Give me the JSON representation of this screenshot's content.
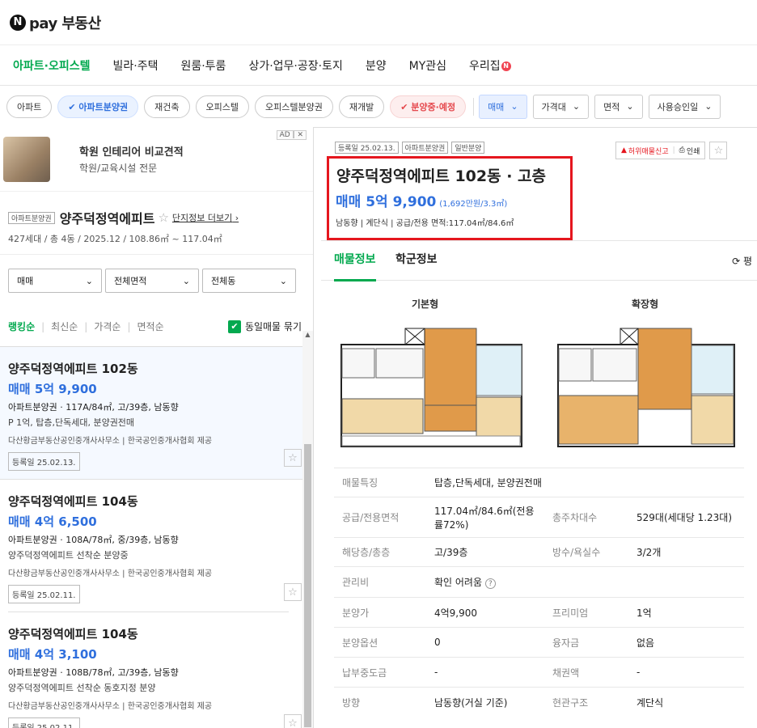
{
  "brand": {
    "logo_letter": "N",
    "name": "pay 부동산"
  },
  "nav": {
    "items": [
      "아파트·오피스텔",
      "빌라·주택",
      "원룸·투룸",
      "상가·업무·공장·토지",
      "분양",
      "MY관심",
      "우리집"
    ],
    "badge": "N"
  },
  "filters": {
    "chips": [
      "아파트",
      "✔ 아파트분양권",
      "재건축",
      "오피스텔",
      "오피스텔분양권",
      "재개발",
      "✔ 분양중·예정"
    ],
    "dropdowns": [
      "매매",
      "가격대",
      "면적",
      "사용승인일"
    ]
  },
  "ad": {
    "title": "학원 인테리어 비교견적",
    "subtitle": "학원/교육시설 전문",
    "tag": "AD",
    "close": "✕"
  },
  "complex": {
    "tag": "아파트분양권",
    "name": "양주덕정역에피트",
    "more": "단지정보 더보기",
    "summary": "427세대 / 총 4동 / 2025.12 / 108.86㎡ ~ 117.04㎡"
  },
  "selects": [
    "매매",
    "전체면적",
    "전체동"
  ],
  "sort": {
    "options": [
      "랭킹순",
      "최신순",
      "가격순",
      "면적순"
    ],
    "same_label": "동일매물 묶기"
  },
  "listings": [
    {
      "title": "양주덕정역에피트 102동",
      "price": "매매 5억 9,900",
      "info": "아파트분양권 · 117A/84㎡, 고/39층, 남동향",
      "desc": "P 1억, 탑층,단독세대, 분양권전매",
      "agency": "다산황금부동산공인중개사사무소 | 한국공인중개사협회 제공",
      "reg": "등록일 25.02.13."
    },
    {
      "title": "양주덕정역에피트 104동",
      "price": "매매 4억 6,500",
      "info": "아파트분양권 · 108A/78㎡, 중/39층, 남동향",
      "desc": "양주덕정역에피트 선착순 분양중",
      "agency": "다산황금부동산공인중개사사무소 | 한국공인중개사협회 제공",
      "reg": "등록일 25.02.11."
    },
    {
      "title": "양주덕정역에피트 104동",
      "price": "매매 4억 3,100",
      "info": "아파트분양권 · 108B/78㎡, 고/39층, 남동향",
      "desc": "양주덕정역에피트 선착순 동호지정 분양",
      "agency": "다산황금부동산공인중개사사무소 | 한국공인중개사협회 제공",
      "reg": "등록일 25.02.11."
    }
  ],
  "detail": {
    "tags": [
      "등록일 25.02.13.",
      "아파트분양권",
      "일반분양"
    ],
    "report": "허위매물신고",
    "print": "인쇄",
    "title": "양주덕정역에피트 102동 · 고층",
    "price": "매매 5억 9,900",
    "unit_price": "(1,692만원/3.3㎡)",
    "specs": "남동향 | 계단식 | 공급/전용 면적:117.04㎡/84.6㎡",
    "tabs": [
      "매물정보",
      "학군정보"
    ],
    "side_btn": "평",
    "plans": [
      "기본형",
      "확장형"
    ],
    "rows": [
      {
        "k1": "매물특징",
        "v1": "탑층,단독세대, 분양권전매"
      },
      {
        "k1": "공급/전용면적",
        "v1": "117.04㎡/84.6㎡(전용률72%)",
        "k2": "총주차대수",
        "v2": "529대(세대당 1.23대)"
      },
      {
        "k1": "해당층/총층",
        "v1": "고/39층",
        "k2": "방수/욕실수",
        "v2": "3/2개"
      },
      {
        "k1": "관리비",
        "v1": "확인 어려움"
      },
      {
        "k1": "분양가",
        "v1": "4억9,900",
        "k2": "프리미엄",
        "v2": "1억"
      },
      {
        "k1": "분양옵션",
        "v1": "0",
        "k2": "융자금",
        "v2": "없음"
      },
      {
        "k1": "납부중도금",
        "v1": "-",
        "k2": "채권액",
        "v2": "-"
      },
      {
        "k1": "방향",
        "v1": "남동향(거실 기준)",
        "k2": "현관구조",
        "v2": "계단식"
      }
    ]
  },
  "colors": {
    "green": "#03a94f",
    "blue": "#2f6fdd",
    "red": "#e5161e"
  }
}
